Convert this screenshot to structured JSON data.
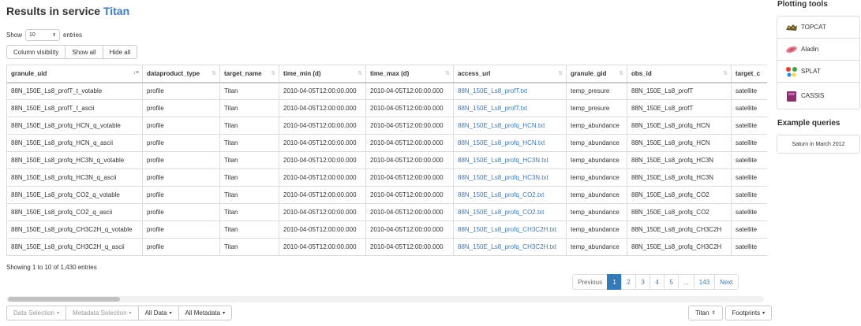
{
  "header": {
    "title_prefix": "Results in service",
    "service": "Titan"
  },
  "length_menu": {
    "show_label": "Show",
    "value": "10",
    "entries_label": "entries"
  },
  "buttons": {
    "column_visibility": "Column visibility",
    "show_all": "Show all",
    "hide_all": "Hide all"
  },
  "table": {
    "columns": [
      "granule_uid",
      "dataproduct_type",
      "target_name",
      "time_min (d)",
      "time_max (d)",
      "access_url",
      "granule_gid",
      "obs_id",
      "target_c"
    ],
    "rows": [
      [
        "88N_150E_Ls8_profT_t_votable",
        "profile",
        "Titan",
        "2010-04-05T12:00:00.000",
        "2010-04-05T12:00:00.000",
        "88N_150E_Ls8_profT.txt",
        "temp_presure",
        "88N_150E_Ls8_profT",
        "satellite"
      ],
      [
        "88N_150E_Ls8_profT_t_ascii",
        "profile",
        "Titan",
        "2010-04-05T12:00:00.000",
        "2010-04-05T12:00:00.000",
        "88N_150E_Ls8_profT.txt",
        "temp_presure",
        "88N_150E_Ls8_profT",
        "satellite"
      ],
      [
        "88N_150E_Ls8_profq_HCN_q_votable",
        "profile",
        "Titan",
        "2010-04-05T12:00:00.000",
        "2010-04-05T12:00:00.000",
        "88N_150E_Ls8_profq_HCN.txt",
        "temp_abundance",
        "88N_150E_Ls8_profq_HCN",
        "satellite"
      ],
      [
        "88N_150E_Ls8_profq_HCN_q_ascii",
        "profile",
        "Titan",
        "2010-04-05T12:00:00.000",
        "2010-04-05T12:00:00.000",
        "88N_150E_Ls8_profq_HCN.txt",
        "temp_abundance",
        "88N_150E_Ls8_profq_HCN",
        "satellite"
      ],
      [
        "88N_150E_Ls8_profq_HC3N_q_votable",
        "profile",
        "Titan",
        "2010-04-05T12:00:00.000",
        "2010-04-05T12:00:00.000",
        "88N_150E_Ls8_profq_HC3N.txt",
        "temp_abundance",
        "88N_150E_Ls8_profq_HC3N",
        "satellite"
      ],
      [
        "88N_150E_Ls8_profq_HC3N_q_ascii",
        "profile",
        "Titan",
        "2010-04-05T12:00:00.000",
        "2010-04-05T12:00:00.000",
        "88N_150E_Ls8_profq_HC3N.txt",
        "temp_abundance",
        "88N_150E_Ls8_profq_HC3N",
        "satellite"
      ],
      [
        "88N_150E_Ls8_profq_CO2_q_votable",
        "profile",
        "Titan",
        "2010-04-05T12:00:00.000",
        "2010-04-05T12:00:00.000",
        "88N_150E_Ls8_profq_CO2.txt",
        "temp_abundance",
        "88N_150E_Ls8_profq_CO2",
        "satellite"
      ],
      [
        "88N_150E_Ls8_profq_CO2_q_ascii",
        "profile",
        "Titan",
        "2010-04-05T12:00:00.000",
        "2010-04-05T12:00:00.000",
        "88N_150E_Ls8_profq_CO2.txt",
        "temp_abundance",
        "88N_150E_Ls8_profq_CO2",
        "satellite"
      ],
      [
        "88N_150E_Ls8_profq_CH3C2H_q_votable",
        "profile",
        "Titan",
        "2010-04-05T12:00:00.000",
        "2010-04-05T12:00:00.000",
        "88N_150E_Ls8_profq_CH3C2H.txt",
        "temp_abundance",
        "88N_150E_Ls8_profq_CH3C2H",
        "satellite"
      ],
      [
        "88N_150E_Ls8_profq_CH3C2H_q_ascii",
        "profile",
        "Titan",
        "2010-04-05T12:00:00.000",
        "2010-04-05T12:00:00.000",
        "88N_150E_Ls8_profq_CH3C2H.txt",
        "temp_abundance",
        "88N_150E_Ls8_profq_CH3C2H",
        "satellite"
      ]
    ]
  },
  "info": "Showing 1 to 10 of 1,430 entries",
  "pagination": {
    "previous": "Previous",
    "pages": [
      "1",
      "2",
      "3",
      "4",
      "5",
      "...",
      "143"
    ],
    "next": "Next",
    "active": "1"
  },
  "bottom_bar": {
    "data_selection": "Data Selection",
    "metadata_selection": "Metadata Selection",
    "all_data": "All Data",
    "all_metadata": "All Metadata",
    "target_select": "Titan",
    "footprints": "Footprints"
  },
  "sidebar": {
    "plotting_title": "Plotting tools",
    "tools": [
      {
        "label": "TOPCAT",
        "icon": "topcat-icon"
      },
      {
        "label": "Aladin",
        "icon": "aladin-icon"
      },
      {
        "label": "SPLAT",
        "icon": "splat-icon"
      },
      {
        "label": "CASSIS",
        "icon": "cassis-icon"
      }
    ],
    "examples_title": "Example queries",
    "example_query": "Saturn in March 2012"
  },
  "colors": {
    "link": "#3a7abd",
    "active_page": "#337ab7",
    "border": "#dddddd"
  }
}
